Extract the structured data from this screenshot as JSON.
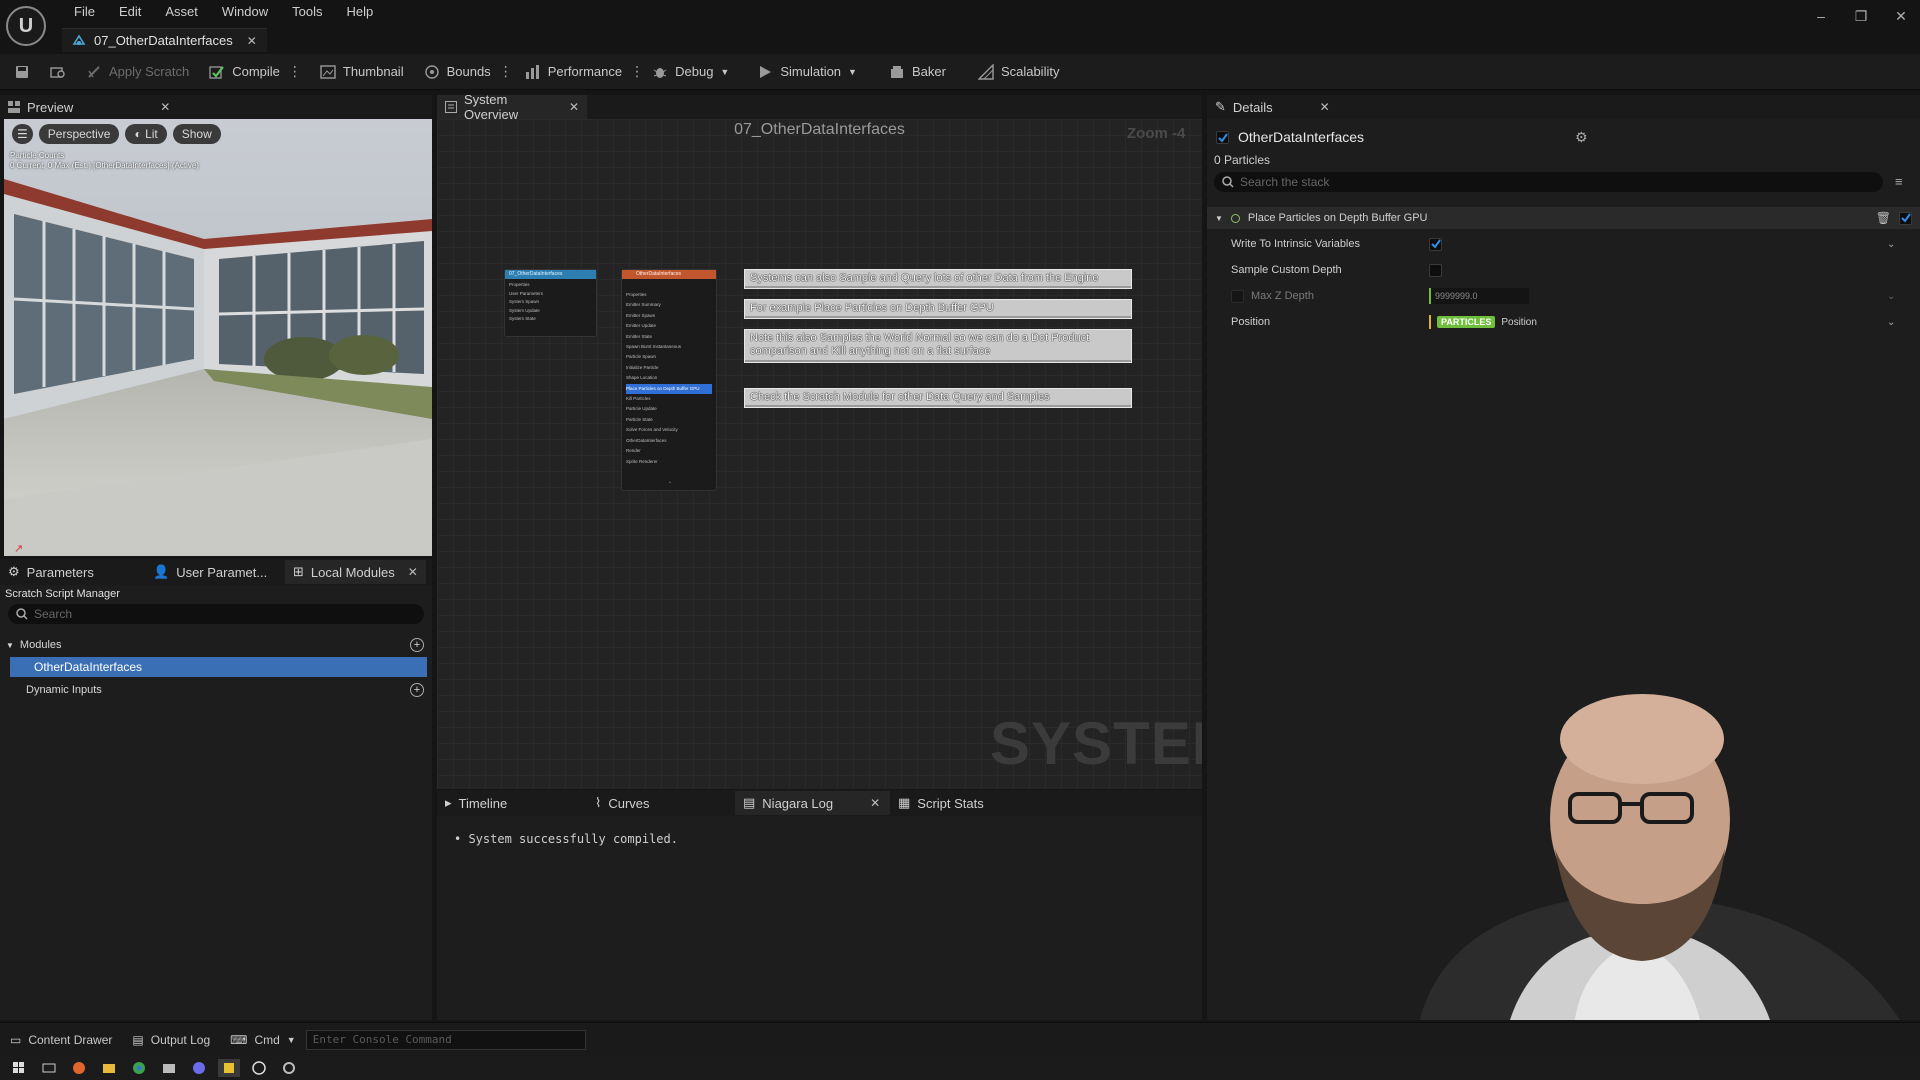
{
  "menu": [
    "File",
    "Edit",
    "Asset",
    "Window",
    "Tools",
    "Help"
  ],
  "document_tab": "07_OtherDataInterfaces",
  "toolbar": {
    "apply_scratch": "Apply Scratch",
    "compile": "Compile",
    "thumbnail": "Thumbnail",
    "bounds": "Bounds",
    "performance": "Performance",
    "debug": "Debug",
    "simulation": "Simulation",
    "baker": "Baker",
    "scalability": "Scalability"
  },
  "preview": {
    "tab": "Preview",
    "perspective": "Perspective",
    "lit": "Lit",
    "show": "Show",
    "overlay_line1": "Particle Counts",
    "overlay_line2": "0 Current, 0 Max (Est.)  [OtherDataInterfaces] (Active)"
  },
  "left_panel": {
    "tabs": [
      "Parameters",
      "User Paramet...",
      "Local Modules"
    ],
    "title": "Scratch Script Manager",
    "search_placeholder": "Search",
    "modules_label": "Modules",
    "module_item": "OtherDataInterfaces",
    "dynamic_inputs": "Dynamic Inputs"
  },
  "graph": {
    "tab": "System Overview",
    "title": "07_OtherDataInterfaces",
    "zoom": "Zoom -4",
    "watermark": "SYSTEM",
    "system_node_title": "07_OtherDataInterfaces",
    "system_node_rows": [
      "Properties",
      "User Parameters",
      "System Spawn",
      "System Update",
      "System State"
    ],
    "emitter_node_title": "OtherDataInterfaces",
    "emitter_node_rows": [
      "Properties",
      "Emitter Summary",
      "Emitter Spawn",
      "Emitter Update",
      "Emitter State",
      "Spawn Burst Instantaneous",
      "Particle Spawn",
      "Initialize Particle",
      "Shape Location",
      "Place Particles on Depth Buffer GPU",
      "Kill Particles",
      "Particle Update",
      "Particle State",
      "Solve Forces and Velocity",
      "OtherDataInterfaces",
      "Render",
      "Sprite Renderer"
    ],
    "comments": [
      "Systems can also Sample and Query lots of other Data from the Engine",
      "For example Place Particles on Depth Buffer GPU",
      "Note this also Samples the World Normal so we can do a Dot Product comparison and Kill anything not on a flat surface",
      "Check the Scratch Module for other Data Query and Samples"
    ]
  },
  "log": {
    "tabs": [
      "Timeline",
      "Curves",
      "Niagara Log",
      "Script Stats"
    ],
    "message": "System successfully compiled."
  },
  "details": {
    "tab": "Details",
    "name": "OtherDataInterfaces",
    "particles": "0 Particles",
    "search_placeholder": "Search the stack",
    "section": "Place Particles on Depth Buffer GPU",
    "props": {
      "write_intrinsic": "Write To Intrinsic Variables",
      "sample_custom_depth": "Sample Custom Depth",
      "max_z_depth": "Max Z Depth",
      "max_z_depth_value": "9999999.0",
      "position": "Position",
      "position_badge": "PARTICLES",
      "position_value": "Position"
    }
  },
  "status": {
    "content_drawer": "Content Drawer",
    "output_log": "Output Log",
    "cmd": "Cmd",
    "console_placeholder": "Enter Console Command"
  },
  "colors": {
    "accent_blue": "#2f6fd6",
    "selection": "#3a6fb5",
    "particles_badge": "#6fbf3c"
  }
}
